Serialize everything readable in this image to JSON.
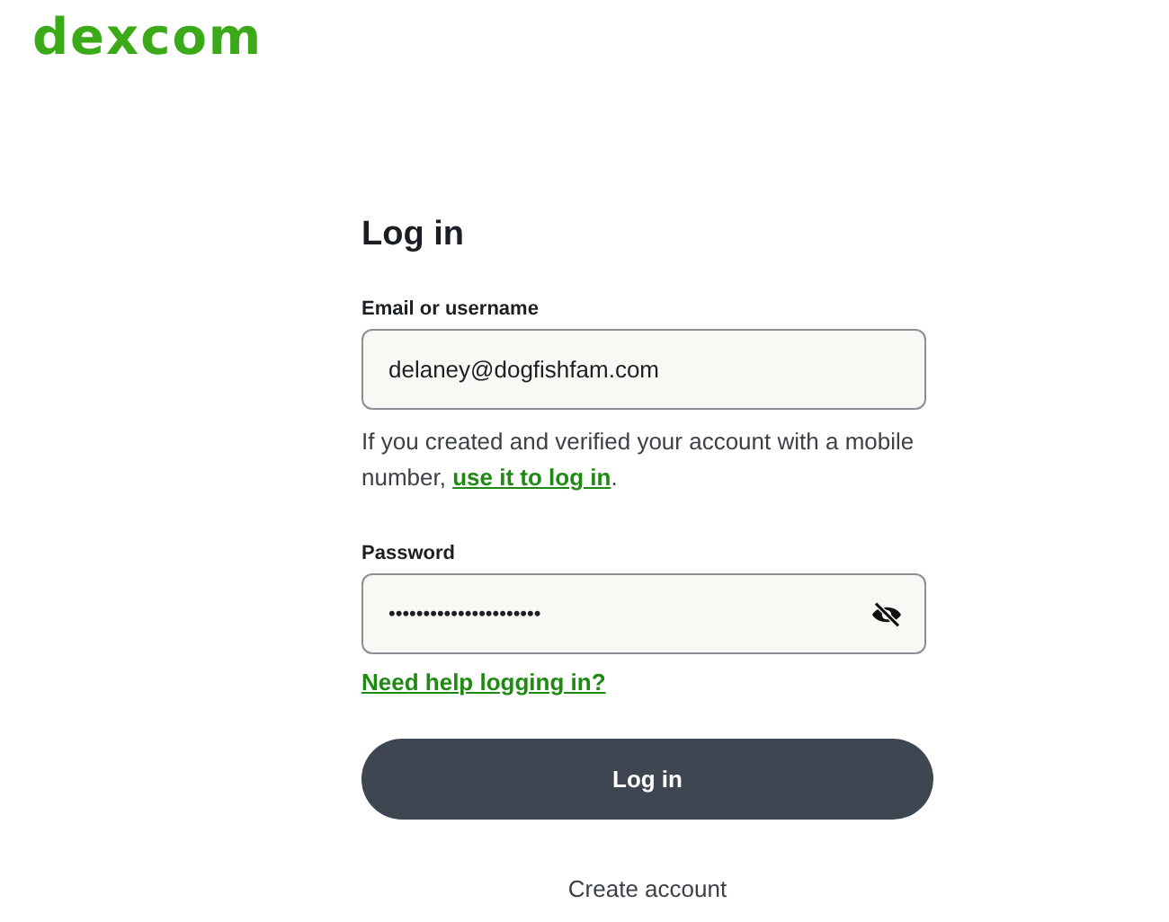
{
  "logo": "dexcom",
  "form": {
    "title": "Log in",
    "email": {
      "label": "Email or username",
      "value": "delaney@dogfishfam.com"
    },
    "hint": {
      "before": "If you created and verified your account with a mobile number, ",
      "link": "use it to log in",
      "after": "."
    },
    "password": {
      "label": "Password",
      "value": "••••••••••••••••••••••"
    },
    "help_link": "Need help logging in?",
    "submit": "Log in",
    "create_account": "Create account"
  }
}
